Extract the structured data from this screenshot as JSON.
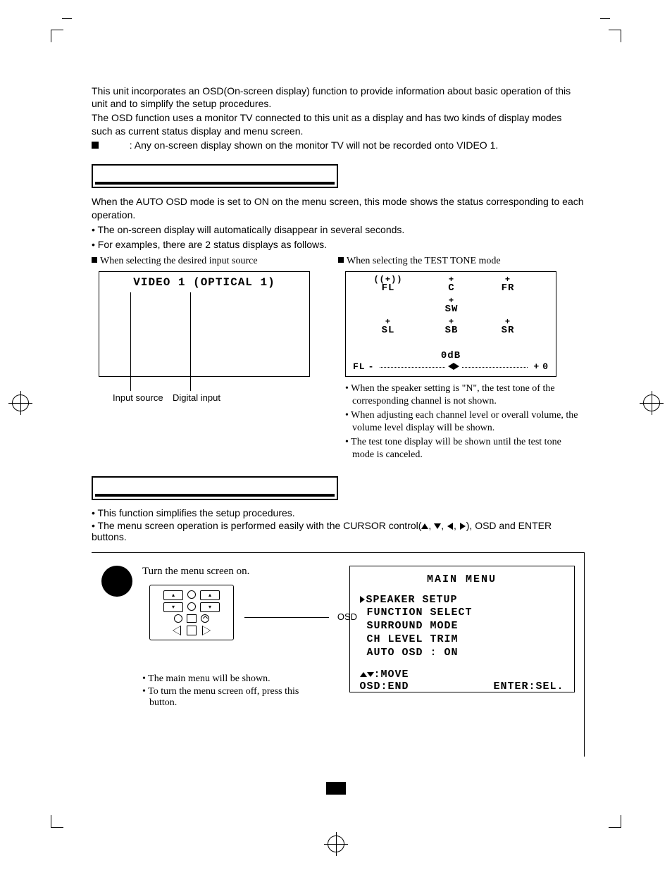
{
  "intro": {
    "p1": "This unit incorporates an OSD(On-screen display) function to provide information about basic operation of this unit and to simplify the setup procedures.",
    "p2": "The OSD function uses a monitor TV connected to this unit as a display and has two kinds of display modes such as current status display and menu screen.",
    "note": ": Any on-screen display shown on the monitor TV will not be recorded onto VIDEO 1."
  },
  "status": {
    "p1": "When the AUTO OSD mode is set to ON on the menu screen, this mode shows the status corresponding to each operation.",
    "p2": "• The on-screen display will automatically disappear in several seconds.",
    "p3": "• For examples, there are 2 status displays as follows."
  },
  "left": {
    "head": "When selecting the desired input source",
    "osd": "VIDEO 1 (OPTICAL 1)",
    "lbl1": "Input source",
    "lbl2": "Digital input"
  },
  "right": {
    "head": "When selecting the TEST TONE mode",
    "tt": {
      "fl": "FL",
      "c": "C",
      "fr": "FR",
      "sw": "SW",
      "sl": "SL",
      "sb": "SB",
      "sr": "SR",
      "level_lbl": "FL",
      "db": "0dB",
      "zero": "0",
      "minus": "-",
      "plus": "+"
    },
    "notes": {
      "n1": "When the speaker setting is \"N\", the test tone of the corresponding channel is not shown.",
      "n2": "When adjusting each channel level or overall volume, the volume level display will be shown.",
      "n3": "The test tone display will be shown until the test tone mode is canceled."
    }
  },
  "menu_intro": {
    "p1": "• This function simplifies the setup procedures.",
    "p2_a": "• The menu screen operation is performed easily with the CURSOR control(",
    "p2_b": "), OSD and ENTER buttons."
  },
  "step1": {
    "title": "Turn the menu screen on.",
    "osd_label": "OSD",
    "n1": "The main menu will be shown.",
    "n2": "To turn the menu screen off, press this button."
  },
  "main_menu": {
    "title": "MAIN MENU",
    "items": [
      "SPEAKER SETUP",
      "FUNCTION SELECT",
      "SURROUND MODE",
      "CH LEVEL TRIM",
      "AUTO OSD : ON"
    ],
    "move": ":MOVE",
    "osd_end": "OSD:END",
    "enter": "ENTER:SEL."
  }
}
